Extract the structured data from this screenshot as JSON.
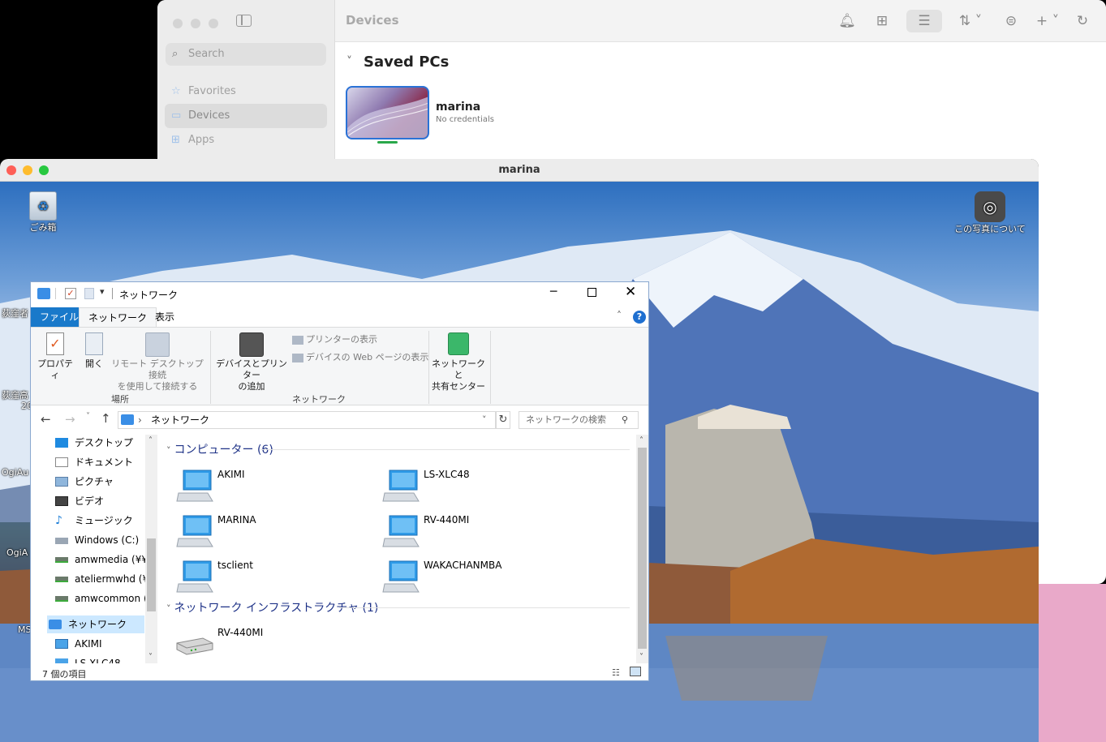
{
  "back_window": {
    "title": "Devices",
    "search_placeholder": "Search",
    "sidebar": [
      {
        "label": "Favorites",
        "icon": "star-icon"
      },
      {
        "label": "Devices",
        "icon": "monitor-icon",
        "selected": true
      },
      {
        "label": "Apps",
        "icon": "apps-icon"
      }
    ],
    "section_title": "Saved PCs",
    "pc": {
      "name": "marina",
      "status": "No credentials"
    }
  },
  "rdp_window": {
    "title": "marina",
    "desktop_icons": {
      "recycle": "ごみ箱",
      "about_photo": "この写真について",
      "partial_1": "荻窪者",
      "partial_2": "荻窪高",
      "partial_3": "20",
      "partial_4": "OgiAu",
      "partial_5": "OgiA",
      "partial_6": "MS"
    }
  },
  "explorer": {
    "title": "ネットワーク",
    "tabs": [
      "ファイル",
      "ネットワーク",
      "表示"
    ],
    "ribbon": {
      "properties": "プロパティ",
      "open": "開く",
      "remote_l1": "リモート デスクトップ接続",
      "remote_l2": "を使用して接続する",
      "group_place": "場所",
      "add_dev_l1": "デバイスとプリンター",
      "add_dev_l2": "の追加",
      "show_printers": "プリンターの表示",
      "show_web": "デバイスの Web ページの表示",
      "group_network": "ネットワーク",
      "center_l1": "ネットワークと",
      "center_l2": "共有センター"
    },
    "address": "ネットワーク",
    "search_placeholder": "ネットワークの検索",
    "nav": [
      "デスクトップ",
      "ドキュメント",
      "ピクチャ",
      "ビデオ",
      "ミュージック",
      "Windows (C:)",
      "amwmedia (¥¥ls-",
      "ateliermwhd (¥¥",
      "amwcommon (¥",
      "ネットワーク",
      "AKIMI",
      "LS-XLC48"
    ],
    "group_computers": "コンピューター (6)",
    "computers": [
      "AKIMI",
      "LS-XLC48",
      "MARINA",
      "RV-440MI",
      "tsclient",
      "WAKACHANMBA"
    ],
    "group_infra": "ネットワーク インフラストラクチャ (1)",
    "infra": [
      "RV-440MI"
    ],
    "status": "7 個の項目"
  },
  "colors": {
    "accent": "#2a72d6",
    "ribbon_file_tab": "#1979ca",
    "group_header": "#1e3287"
  }
}
